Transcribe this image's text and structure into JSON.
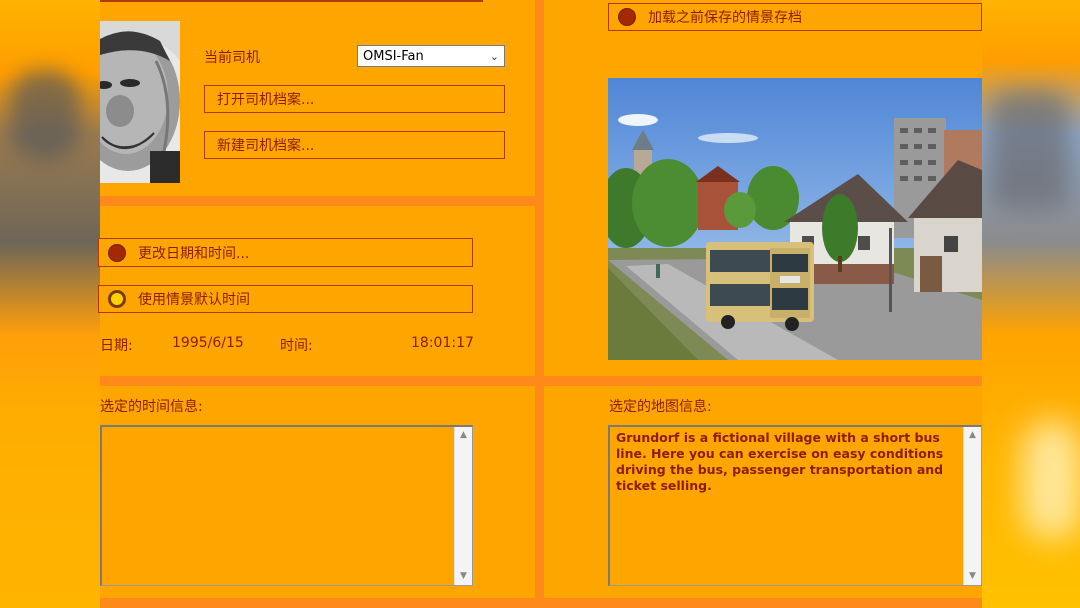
{
  "driver": {
    "label": "当前司机",
    "selected": "OMSI-Fan",
    "open_button": "打开司机档案...",
    "new_button": "新建司机档案..."
  },
  "time": {
    "change_option": "更改日期和时间...",
    "default_option": "使用情景默认时间",
    "date_label": "日期:",
    "date_value": "1995/6/15",
    "time_label": "时间:",
    "time_value": "18:01:17"
  },
  "load": {
    "option": "加载之前保存的情景存档"
  },
  "info": {
    "time_info_label": "选定的时间信息:",
    "time_info_text": "",
    "map_info_label": "选定的地图信息:",
    "map_info_text": "Grundorf is a fictional village with a short bus line. Here you can exercise on easy conditions driving the bus, passenger transportation and ticket selling."
  },
  "icons": {
    "dropdown": "chevron-down-icon",
    "scroll_up": "scroll-up-icon",
    "scroll_down": "scroll-down-icon"
  },
  "colors": {
    "panel": "#ffa500",
    "divider": "#ff8a1a",
    "text": "#8a1f00",
    "radio_selected": "#ffd200",
    "radio_unselected": "#a32900"
  }
}
